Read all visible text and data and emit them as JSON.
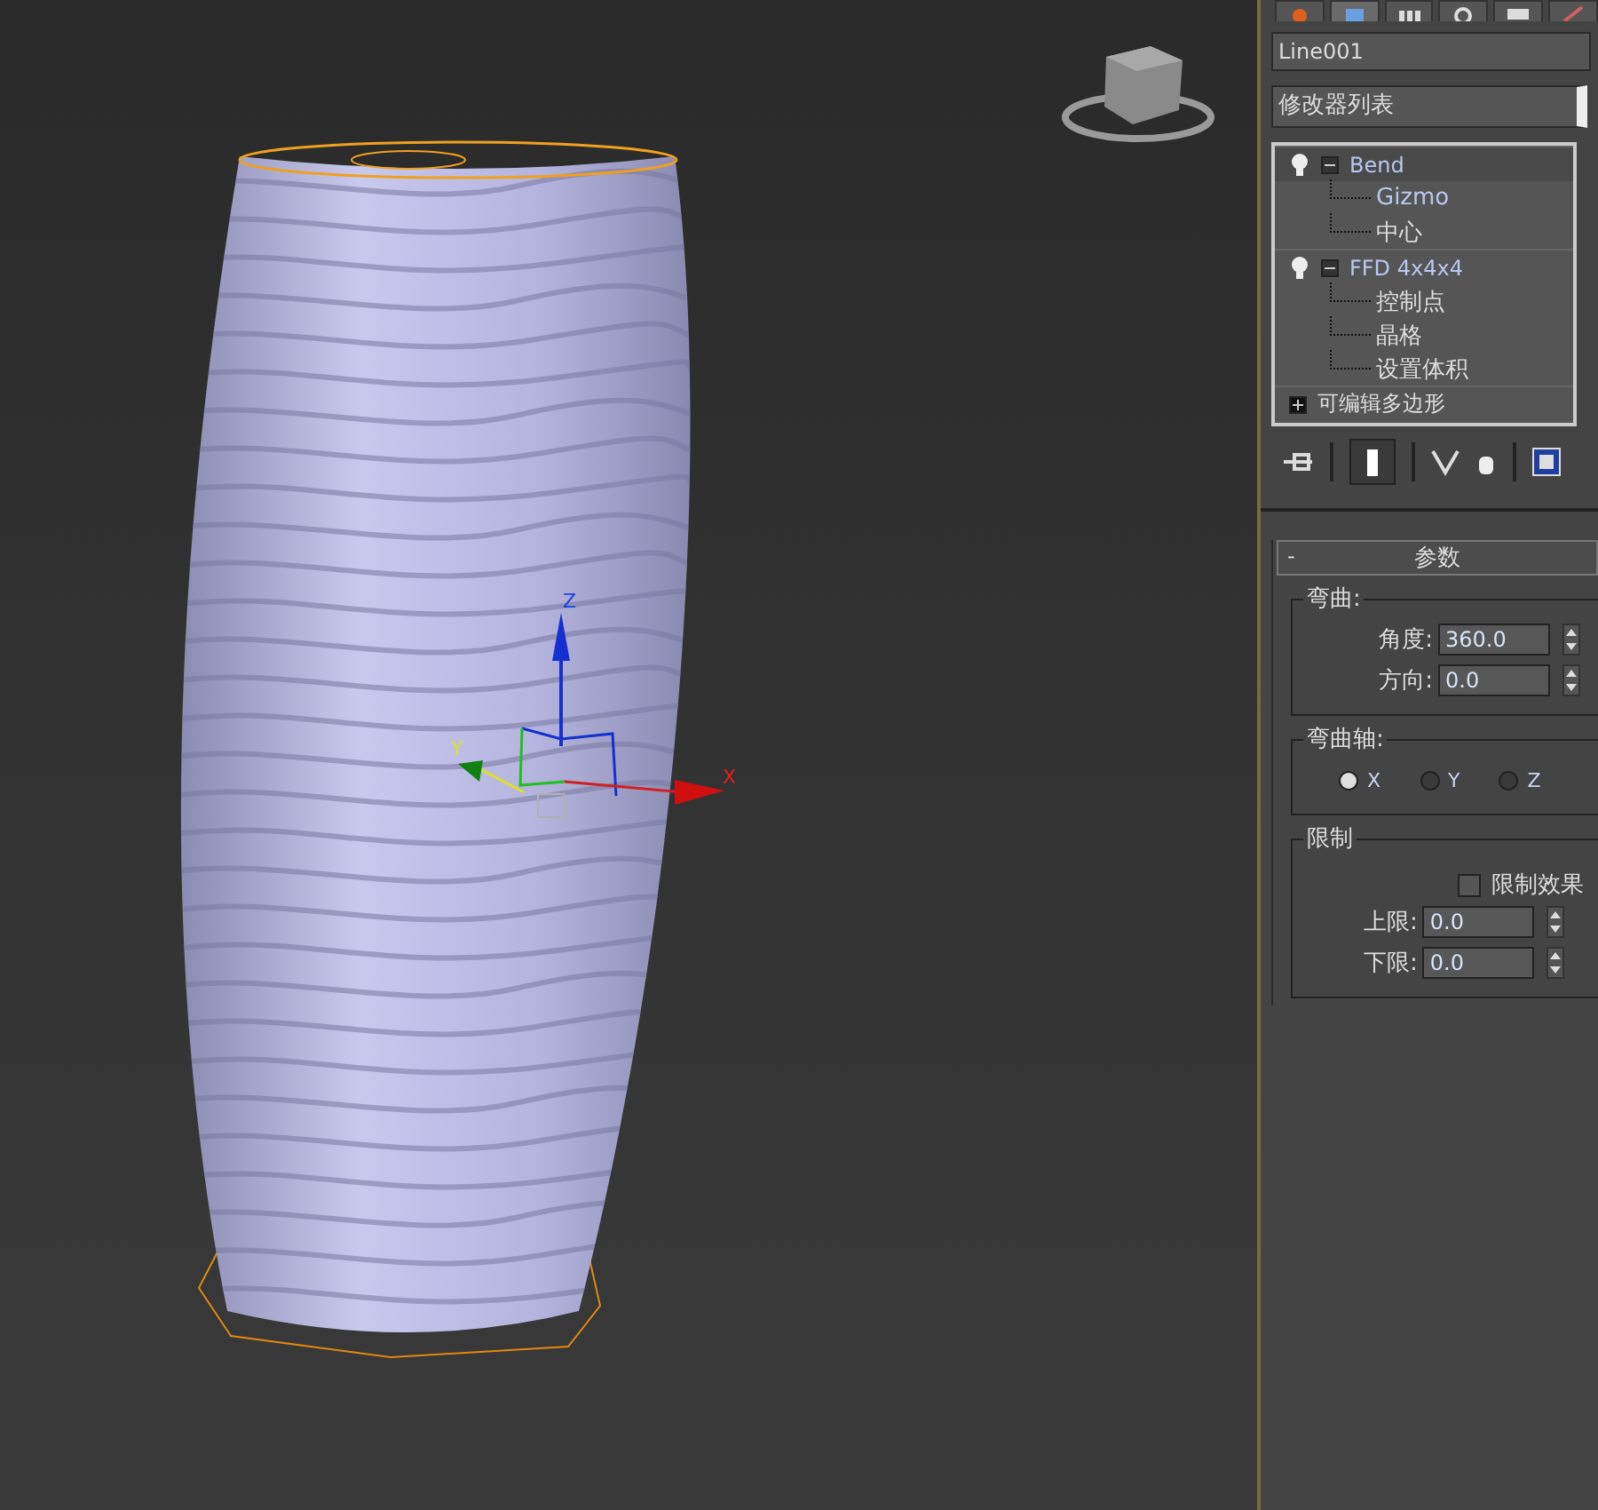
{
  "viewport": {
    "gizmo": {
      "x_label": "X",
      "y_label": "Y",
      "z_label": "Z"
    }
  },
  "command_panel": {
    "tabs": [
      {
        "kind": "create",
        "selected": false
      },
      {
        "kind": "modify",
        "selected": true
      },
      {
        "kind": "hierarchy",
        "selected": false
      },
      {
        "kind": "motion",
        "selected": false
      },
      {
        "kind": "display",
        "selected": false
      },
      {
        "kind": "utilities",
        "selected": false
      }
    ],
    "object_name": "Line001",
    "modifier_list": "修改器列表",
    "stack": [
      {
        "label": "Bend",
        "expanded": true,
        "selected": true,
        "children": [
          {
            "label": "Gizmo",
            "selected": false
          },
          {
            "label": "中心",
            "selected": false
          }
        ]
      },
      {
        "label": "FFD 4x4x4",
        "expanded": true,
        "selected": false,
        "children": [
          {
            "label": "控制点",
            "selected": false
          },
          {
            "label": "晶格",
            "selected": false
          },
          {
            "label": "设置体积",
            "selected": false
          }
        ]
      },
      {
        "label": "可编辑多边形",
        "expanded": false,
        "selected": false
      }
    ],
    "rollout": {
      "collapse": "-",
      "title": "参数",
      "bend": {
        "title": "弯曲:",
        "fields": [
          {
            "label": "角度:",
            "value": "360.0"
          },
          {
            "label": "方向:",
            "value": "0.0"
          }
        ]
      },
      "axis": {
        "title": "弯曲轴:",
        "options": [
          {
            "label": "X",
            "selected": true
          },
          {
            "label": "Y",
            "selected": false
          },
          {
            "label": "Z",
            "selected": false
          }
        ]
      },
      "limit": {
        "title": "限制",
        "checkbox": {
          "label": "限制效果",
          "checked": false
        },
        "fields": [
          {
            "label": "上限:",
            "value": "0.0"
          },
          {
            "label": "下限:",
            "value": "0.0"
          }
        ]
      }
    }
  }
}
